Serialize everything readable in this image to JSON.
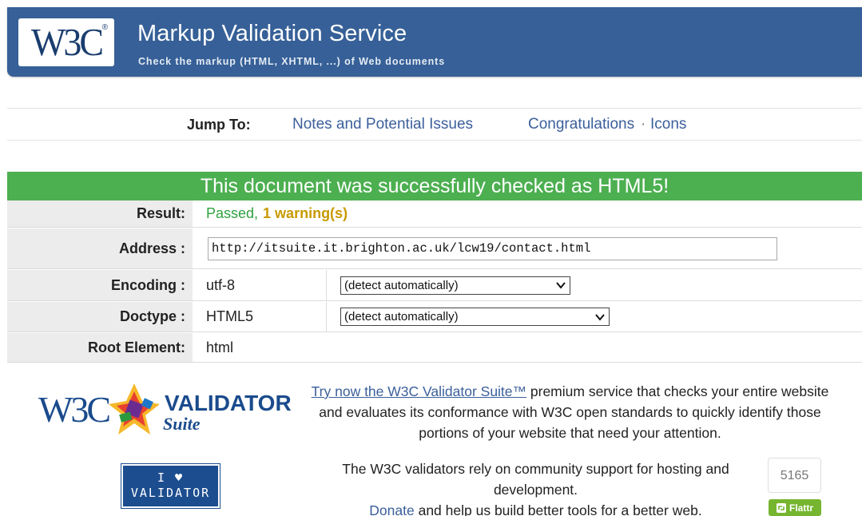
{
  "banner": {
    "logo_text": "W3C",
    "logo_mark": "®",
    "title": "Markup Validation Service",
    "subtitle": "Check the markup (HTML, XHTML, ...) of Web documents"
  },
  "jump_nav": {
    "label": "Jump To:",
    "links": [
      "Notes and Potential Issues",
      "Congratulations",
      "Icons"
    ],
    "separator": "·"
  },
  "result": {
    "header": "This document was successfully checked as HTML5!",
    "rows": {
      "result": {
        "label": "Result:",
        "passed": "Passed,",
        "warning": "1 warning(s)"
      },
      "address": {
        "label": "Address :",
        "value": "http://itsuite.it.brighton.ac.uk/lcw19/contact.html"
      },
      "encoding": {
        "label": "Encoding :",
        "value": "utf-8",
        "select": "(detect automatically)"
      },
      "doctype": {
        "label": "Doctype :",
        "value": "HTML5",
        "select": "(detect automatically)"
      },
      "root": {
        "label": "Root Element:",
        "value": "html"
      }
    }
  },
  "promo": {
    "logo_w3c": "W3C",
    "logo_validator": "VALIDATOR",
    "logo_suite": "Suite",
    "link": "Try now the W3C Validator Suite™",
    "text": " premium service that checks your entire website and evaluates its conformance with W3C open standards to quickly identify those portions of your website that need your attention."
  },
  "support": {
    "badge_line1": "I ♥",
    "badge_line2": "VALIDATOR",
    "text": "The W3C validators rely on community support for hosting and development.",
    "donate_link": "Donate",
    "donate_text": " and help us build better tools for a better web."
  },
  "flattr": {
    "count": "5165",
    "label": "Flattr"
  },
  "colors": {
    "banner": "#366097",
    "success": "#4caf50",
    "link": "#3b5f9b",
    "warning": "#c79a00"
  }
}
